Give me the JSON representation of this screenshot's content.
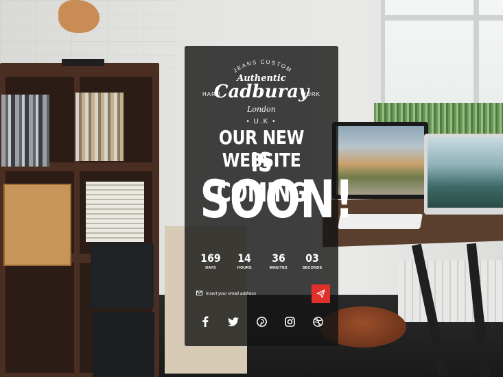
{
  "logo": {
    "top_arc": "JEANS CUSTOM",
    "tagline": "Authentic",
    "brand": "Cadburay",
    "left_label": "HARD",
    "right_label": "WORK",
    "city": "London",
    "country": "U.K"
  },
  "headline": {
    "line1": "OUR NEW WEBSITE",
    "line2": "IS COMING",
    "line3": "SOON!"
  },
  "countdown": [
    {
      "value": "169",
      "label": "DAYS"
    },
    {
      "value": "14",
      "label": "HOURS"
    },
    {
      "value": "36",
      "label": "MINUTES"
    },
    {
      "value": "03",
      "label": "SECONDS"
    }
  ],
  "subscribe": {
    "placeholder": "Insert your email address",
    "button_icon": "paper-plane-icon"
  },
  "social": [
    {
      "name": "facebook-icon"
    },
    {
      "name": "twitter-icon"
    },
    {
      "name": "pinterest-icon"
    },
    {
      "name": "instagram-icon"
    },
    {
      "name": "dribbble-icon"
    }
  ],
  "colors": {
    "accent": "#e0302b",
    "card_bg": "rgba(20,20,20,0.8)",
    "text": "#ffffff"
  }
}
